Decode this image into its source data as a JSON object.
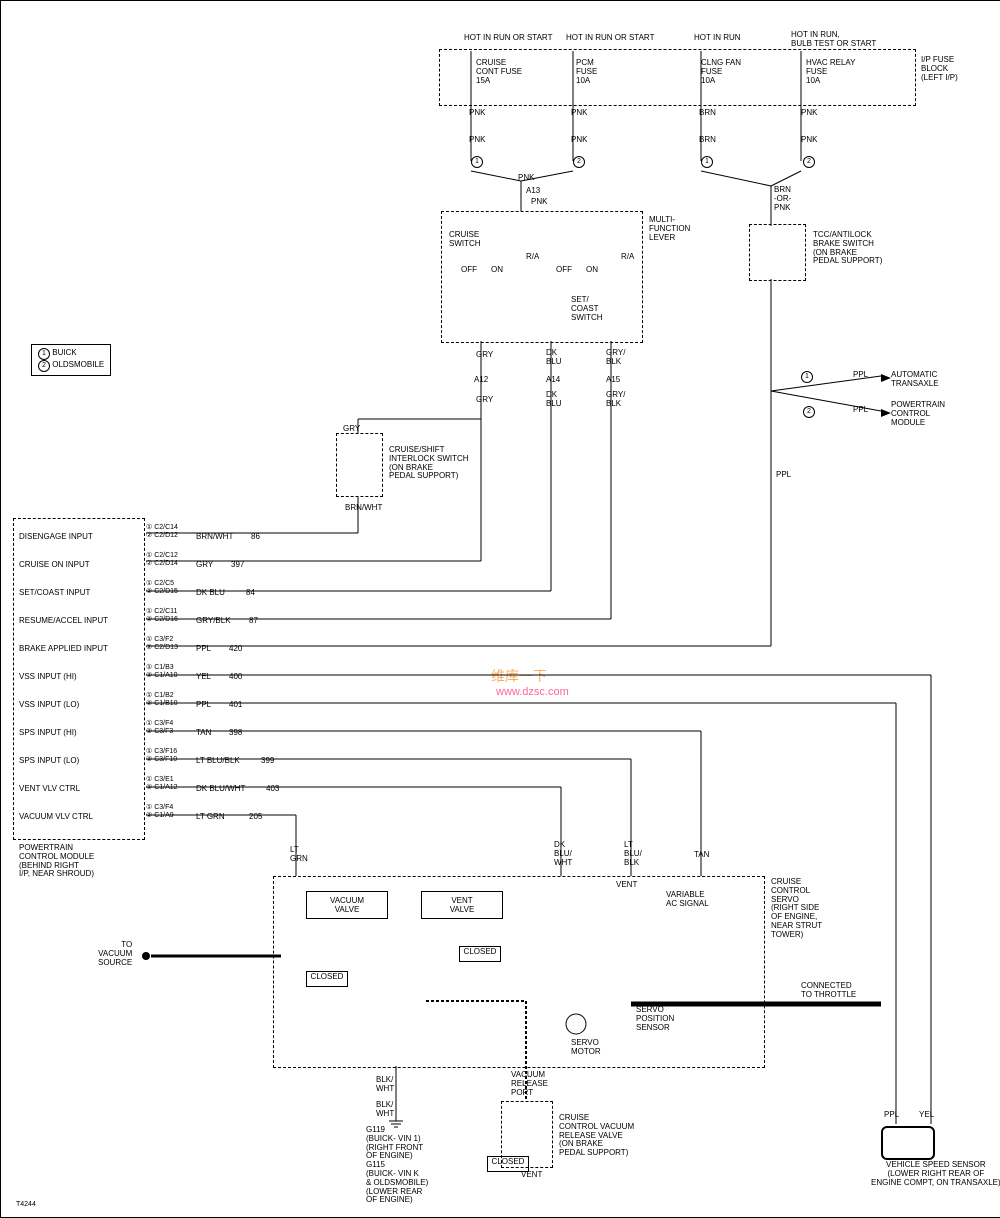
{
  "top_labels": {
    "hot1": "HOT IN RUN OR START",
    "hot2": "HOT IN RUN OR START",
    "hot3": "HOT IN RUN",
    "hot4": "HOT IN RUN,\nBULB TEST OR START"
  },
  "fuse_block": {
    "title": "I/P FUSE\nBLOCK\n(LEFT I/P)",
    "fuses": {
      "cruise": "CRUISE\nCONT FUSE\n15A",
      "pcm": "PCM\nFUSE\n10A",
      "clng": "CLNG FAN\nFUSE\n10A",
      "hvac": "HVAC RELAY\nFUSE\n10A"
    }
  },
  "wires": {
    "pnk": "PNK",
    "brn": "BRN",
    "gry": "GRY",
    "dk_blu": "DK\nBLU",
    "gry_blk": "GRY/\nBLK",
    "brn_or_pnk": "BRN\n-OR-\nPNK",
    "ppl": "PPL",
    "brn_wht": "BRN/WHT",
    "yel": "YEL",
    "blk_wht": "BLK/\nWHT",
    "lt_grn": "LT\nGRN",
    "dk_blu_wht": "DK\nBLU/\nWHT",
    "lt_blu_blk": "LT\nBLU/\nBLK",
    "tan": "TAN",
    "lt_blu_blk2": "LT BLU/BLK",
    "dk_blu_wht2": "DK BLU/WHT"
  },
  "components": {
    "cruise_switch": "CRUISE\nSWITCH",
    "multi_lever": "MULTI-\nFUNCTION\nLEVER",
    "set_coast": "SET/\nCOAST\nSWITCH",
    "tcc_brake": "TCC/ANTILOCK\nBRAKE SWITCH\n(ON BRAKE\nPEDAL SUPPORT)",
    "auto_transaxle": "AUTOMATIC\nTRANSAXLE",
    "pcm_arrow": "POWERTRAIN\nCONTROL\nMODULE",
    "interlock": "CRUISE/SHIFT\nINTERLOCK SWITCH\n(ON BRAKE\nPEDAL SUPPORT)",
    "vacuum_valve": "VACUUM\nVALVE",
    "vent_valve": "VENT\nVALVE",
    "closed": "CLOSED",
    "variable": "VARIABLE\nAC SIGNAL",
    "servo_pos": "SERVO\nPOSITION\nSENSOR",
    "servo_motor": "SERVO\nMOTOR",
    "to_vacuum": "TO\nVACUUM\nSOURCE",
    "vac_release_port": "VACUUM\nRELEASE\nPORT",
    "connected_throttle": "CONNECTED\nTO THROTTLE",
    "cruise_servo": "CRUISE\nCONTROL\nSERVO\n(RIGHT SIDE\nOF ENGINE,\nNEAR STRUT\nTOWER)",
    "release_valve": "CRUISE\nCONTROL VACUUM\nRELEASE VALVE\n(ON BRAKE\nPEDAL SUPPORT)",
    "vent": "VENT",
    "vss": "VEHICLE SPEED SENSOR\n(LOWER RIGHT REAR OF\nENGINE COMPT, ON TRANSAXLE)",
    "grounds": "G119\n(BUICK- VIN 1)\n(RIGHT FRONT\nOF ENGINE)\nG115\n(BUICK- VIN K\n& OLDSMOBILE)\n(LOWER REAR\nOF ENGINE)"
  },
  "legend": {
    "buick": "BUICK",
    "olds": "OLDSMOBILE"
  },
  "pcm_module": {
    "title": "POWERTRAIN\nCONTROL MODULE\n(BEHIND RIGHT\nI/P, NEAR SHROUD)",
    "pins": [
      {
        "name": "DISENGAGE INPUT",
        "refs": "① C2/C14\n② C2/D12",
        "wire": "BRN/WHT",
        "code": "86"
      },
      {
        "name": "CRUISE ON INPUT",
        "refs": "① C2/C12\n② C2/D14",
        "wire": "GRY",
        "code": "397"
      },
      {
        "name": "SET/COAST INPUT",
        "refs": "① C2/C5\n② C2/D15",
        "wire": "DK BLU",
        "code": "84"
      },
      {
        "name": "RESUME/ACCEL INPUT",
        "refs": "① C2/C11\n② C2/D16",
        "wire": "GRY/BLK",
        "code": "87"
      },
      {
        "name": "BRAKE APPLIED INPUT",
        "refs": "① C3/F2\n② C2/D13",
        "wire": "PPL",
        "code": "420"
      },
      {
        "name": "VSS INPUT (HI)",
        "refs": "① C1/B3\n② C1/A10",
        "wire": "YEL",
        "code": "400"
      },
      {
        "name": "VSS INPUT (LO)",
        "refs": "① C1/B2\n② C1/B10",
        "wire": "PPL",
        "code": "401"
      },
      {
        "name": "SPS INPUT (HI)",
        "refs": "① C3/F4\n② C3/F3",
        "wire": "TAN",
        "code": "398"
      },
      {
        "name": "SPS INPUT (LO)",
        "refs": "① C3/F16\n② C3/F10",
        "wire": "LT BLU/BLK",
        "code": "399"
      },
      {
        "name": "VENT VLV CTRL",
        "refs": "① C3/E1\n② C1/A12",
        "wire": "DK BLU/WHT",
        "code": "403"
      },
      {
        "name": "VACUUM VLV CTRL",
        "refs": "① C3/F4\n② C1/A9",
        "wire": "LT GRN",
        "code": "205"
      }
    ]
  },
  "switch_labels": {
    "off": "OFF",
    "on": "ON",
    "ra": "R/A"
  },
  "pin_codes": {
    "a13": "A13",
    "a12": "A12",
    "a14": "A14",
    "a15": "A15"
  },
  "watermark": "维库一下",
  "watermark_url": "www.dzsc.com",
  "doc_id": "T4244"
}
